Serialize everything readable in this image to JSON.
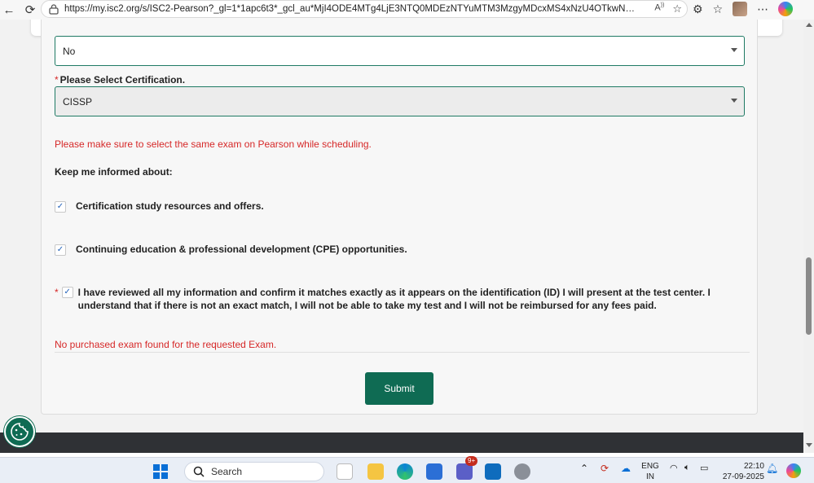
{
  "browser": {
    "url": "https://my.isc2.org/s/ISC2-Pearson?_gl=1*1apc6t3*_gcl_au*MjI4ODE4MTg4LjE3NTQ0MDEzNTYuMTM3MzgyMDcxMS4xNzU4OTkwNzEwLjE3NTg..."
  },
  "form": {
    "prev_select_value": "No",
    "cert_label": "Please Select Certification.",
    "cert_value": "CISSP",
    "pearson_warning": "Please make sure to select the same exam on Pearson while scheduling.",
    "keep_informed_label": "Keep me informed about:",
    "opt_study": "Certification study resources and offers.",
    "opt_cpe": "Continuing education & professional development (CPE) opportunities.",
    "agree_text": "I have reviewed all my information and confirm it matches exactly as it appears on the identification (ID) I will present at the test center. I understand that if there is not an exact match, I will not be able to take my test and I will not be reimbursed for any fees paid.",
    "error_text": "No purchased exam found for the requested Exam.",
    "submit_label": "Submit",
    "required_mark": "*",
    "checkmark": "✓"
  },
  "taskbar": {
    "search_label": "Search",
    "badge": "9+",
    "lang_top": "ENG",
    "lang_bottom": "IN",
    "time": "22:10",
    "date": "27-09-2025"
  },
  "colors": {
    "accent": "#0f6b53",
    "error": "#d62828",
    "check": "#1f5fb8"
  }
}
